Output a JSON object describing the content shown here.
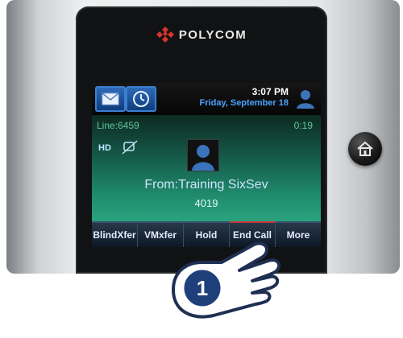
{
  "brand": {
    "name": "POLYCOM"
  },
  "topbar": {
    "messages_icon": "envelope-icon",
    "clock_icon": "clock-icon",
    "time": "3:07 PM",
    "date": "Friday, September 18"
  },
  "call": {
    "line": "Line:6459",
    "duration": "0:19",
    "from": "From:Training SixSev",
    "extension": "4019"
  },
  "softkeys": [
    {
      "label": "BlindXfer"
    },
    {
      "label": "VMxfer"
    },
    {
      "label": "Hold"
    },
    {
      "label": "End Call"
    },
    {
      "label": "More"
    }
  ],
  "callout": {
    "number": "1"
  },
  "colors": {
    "accent_blue": "#3c7fd1",
    "date_blue": "#4ba3ff",
    "call_green": "#29a37e",
    "end_call_red": "#c9323a"
  }
}
